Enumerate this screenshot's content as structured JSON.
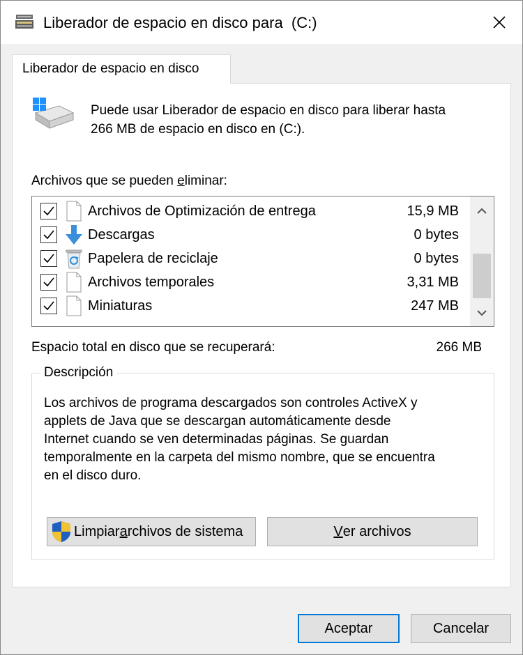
{
  "window": {
    "title": "Liberador de espacio en disco para  (C:)",
    "close_icon": "close-icon"
  },
  "tabs": [
    {
      "label": "Liberador de espacio en disco",
      "active": true
    }
  ],
  "intro": {
    "line1": "Puede usar Liberador de espacio en disco para liberar hasta",
    "line2": "266 MB de espacio en disco en  (C:)."
  },
  "files": {
    "label_pre": "Archivos que se pueden ",
    "label_accel": "e",
    "label_post": "liminar:",
    "items": [
      {
        "name": "Archivos de Optimización de entrega",
        "size": "15,9 MB",
        "checked": true,
        "icon": "file-icon"
      },
      {
        "name": "Descargas",
        "size": "0 bytes",
        "checked": true,
        "icon": "download-arrow-icon"
      },
      {
        "name": "Papelera de reciclaje",
        "size": "0 bytes",
        "checked": true,
        "icon": "recycle-bin-icon"
      },
      {
        "name": "Archivos temporales",
        "size": "3,31 MB",
        "checked": true,
        "icon": "file-icon"
      },
      {
        "name": "Miniaturas",
        "size": "247 MB",
        "checked": true,
        "icon": "file-icon"
      }
    ]
  },
  "total": {
    "label": "Espacio total en disco que se recuperará:",
    "value": "266 MB"
  },
  "description": {
    "title": "Descripción",
    "lines": [
      "Los archivos de programa descargados son controles ActiveX y",
      "applets de Java que se descargan automáticamente desde",
      "Internet cuando se ven determinadas páginas. Se guardan",
      "temporalmente en la carpeta del mismo nombre, que se encuentra",
      "en el disco duro."
    ]
  },
  "buttons": {
    "clean_system_pre": "Limpiar ",
    "clean_system_accel": "a",
    "clean_system_post": "rchivos de sistema",
    "view_files_accel": "V",
    "view_files_post": "er archivos",
    "ok": "Aceptar",
    "cancel": "Cancelar"
  },
  "colors": {
    "accent": "#0078d7",
    "window_bg": "#f0f0f0",
    "panel_bg": "#ffffff"
  }
}
